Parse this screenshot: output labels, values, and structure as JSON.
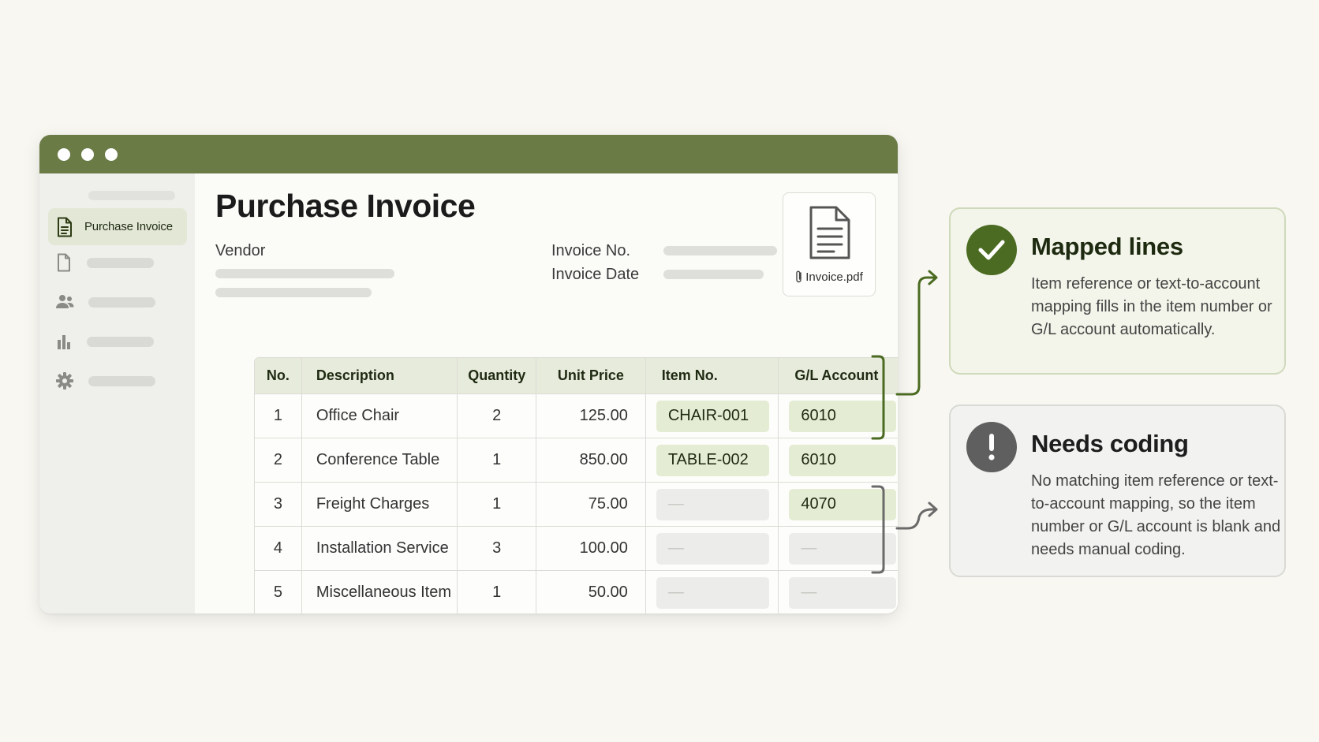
{
  "window": {
    "sidebar": {
      "active_label": "Purchase Invoice",
      "items": [
        {
          "icon": "document-icon"
        },
        {
          "icon": "users-icon"
        },
        {
          "icon": "bar-chart-icon"
        },
        {
          "icon": "gear-icon"
        }
      ]
    },
    "page_title": "Purchase Invoice",
    "vendor_label": "Vendor",
    "invoice_no_label": "Invoice No.",
    "invoice_date_label": "Invoice Date",
    "attachment": {
      "file_name": "Invoice.pdf",
      "icon": "paperclip-icon"
    }
  },
  "table": {
    "headers": [
      "No.",
      "Description",
      "Quantity",
      "Unit Price",
      "Item No.",
      "G/L Account"
    ],
    "rows": [
      {
        "no": "1",
        "description": "Office Chair",
        "quantity": "2",
        "unit_price": "125.00",
        "item_no": "CHAIR-001",
        "gl_account": "6010"
      },
      {
        "no": "2",
        "description": "Conference Table",
        "quantity": "1",
        "unit_price": "850.00",
        "item_no": "TABLE-002",
        "gl_account": "6010"
      },
      {
        "no": "3",
        "description": "Freight Charges",
        "quantity": "1",
        "unit_price": "75.00",
        "item_no": "—",
        "gl_account": "4070"
      },
      {
        "no": "4",
        "description": "Installation Service",
        "quantity": "3",
        "unit_price": "100.00",
        "item_no": "—",
        "gl_account": "—"
      },
      {
        "no": "5",
        "description": "Miscellaneous Item",
        "quantity": "1",
        "unit_price": "50.00",
        "item_no": "—",
        "gl_account": "—"
      }
    ]
  },
  "callouts": {
    "mapped": {
      "title": "Mapped lines",
      "body": "Item reference or text-to-account mapping fills in the item number or G/L account automatically.",
      "icon": "check-icon"
    },
    "needs_coding": {
      "title": "Needs coding",
      "body": "No matching item reference or text-to-account mapping, so the item number or G/L account is blank and needs manual coding.",
      "icon": "exclamation-icon"
    }
  },
  "colors": {
    "titlebar": "#6b7b46",
    "mapped_accent": "#4b6b22",
    "needs_accent": "#5f5f5f",
    "mapped_fill": "#e5ecd4",
    "blank_fill": "#ececea"
  }
}
